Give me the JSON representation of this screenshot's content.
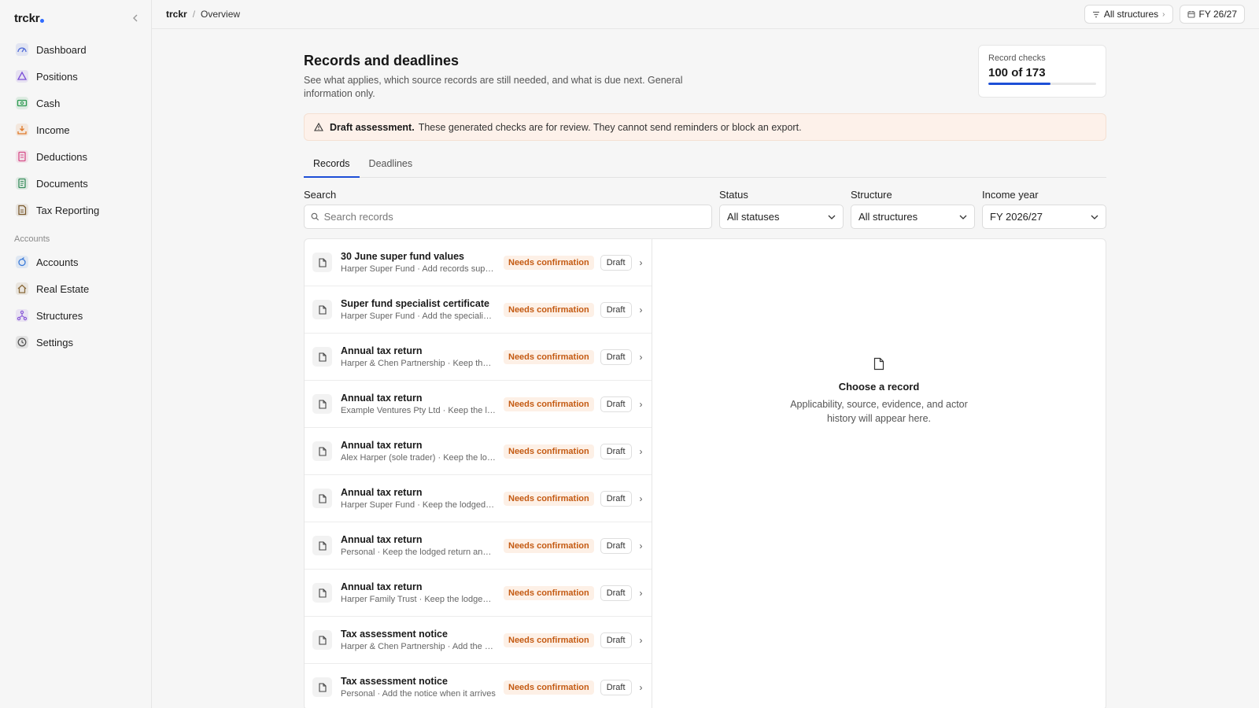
{
  "app": {
    "name": "trckr"
  },
  "sidebar": {
    "items": [
      {
        "label": "Dashboard",
        "icon": "dashboard-icon",
        "color": "#4f6bd8"
      },
      {
        "label": "Positions",
        "icon": "positions-icon",
        "color": "#7b4fd8"
      },
      {
        "label": "Cash",
        "icon": "cash-icon",
        "color": "#2e9a52"
      },
      {
        "label": "Income",
        "icon": "income-icon",
        "color": "#e07a2a"
      },
      {
        "label": "Deductions",
        "icon": "deductions-icon",
        "color": "#d64f8a"
      },
      {
        "label": "Documents",
        "icon": "documents-icon",
        "color": "#3a8f5e"
      },
      {
        "label": "Tax Reporting",
        "icon": "tax-reporting-icon",
        "color": "#7a5a2e"
      }
    ],
    "section_label": "Accounts",
    "account_items": [
      {
        "label": "Accounts",
        "icon": "accounts-icon",
        "color": "#3a7ad8"
      },
      {
        "label": "Real Estate",
        "icon": "real-estate-icon",
        "color": "#8a6a3a"
      },
      {
        "label": "Structures",
        "icon": "structures-icon",
        "color": "#8a5ad8"
      },
      {
        "label": "Settings",
        "icon": "settings-icon",
        "color": "#555555"
      }
    ]
  },
  "topbar": {
    "breadcrumb": [
      "trckr",
      "Overview"
    ],
    "structures_button": "All structures",
    "year_button": "FY 26/27"
  },
  "header": {
    "title": "Records and deadlines",
    "subtitle": "See what applies, which source records are still needed, and what is due next. General information only."
  },
  "checks": {
    "label": "Record checks",
    "value_text": "100 of 173",
    "done": 100,
    "total": 173,
    "accent": "#1d4fd7"
  },
  "banner": {
    "bold": "Draft assessment.",
    "text": "These generated checks are for review. They cannot send reminders or block an export."
  },
  "tabs": [
    {
      "label": "Records",
      "active": true
    },
    {
      "label": "Deadlines",
      "active": false
    }
  ],
  "filters": {
    "search_label": "Search",
    "search_placeholder": "Search records",
    "status_label": "Status",
    "status_value": "All statuses",
    "structure_label": "Structure",
    "structure_value": "All structures",
    "year_label": "Income year",
    "year_value": "FY 2026/27"
  },
  "records": [
    {
      "title": "30 June super fund values",
      "subtitle": "Harper Super Fund · Add records supp...",
      "status": "Needs confirmation",
      "state": "Draft"
    },
    {
      "title": "Super fund specialist certificate",
      "subtitle": "Harper Super Fund · Add the specialist ...",
      "status": "Needs confirmation",
      "state": "Draft"
    },
    {
      "title": "Annual tax return",
      "subtitle": "Harper & Chen Partnership · Keep the l...",
      "status": "Needs confirmation",
      "state": "Draft"
    },
    {
      "title": "Annual tax return",
      "subtitle": "Example Ventures Pty Ltd · Keep the lo...",
      "status": "Needs confirmation",
      "state": "Draft"
    },
    {
      "title": "Annual tax return",
      "subtitle": "Alex Harper (sole trader) · Keep the lod...",
      "status": "Needs confirmation",
      "state": "Draft"
    },
    {
      "title": "Annual tax return",
      "subtitle": "Harper Super Fund · Keep the lodged re...",
      "status": "Needs confirmation",
      "state": "Draft"
    },
    {
      "title": "Annual tax return",
      "subtitle": "Personal · Keep the lodged return and fi...",
      "status": "Needs confirmation",
      "state": "Draft"
    },
    {
      "title": "Annual tax return",
      "subtitle": "Harper Family Trust · Keep the lodged r...",
      "status": "Needs confirmation",
      "state": "Draft"
    },
    {
      "title": "Tax assessment notice",
      "subtitle": "Harper & Chen Partnership · Add the no...",
      "status": "Needs confirmation",
      "state": "Draft"
    },
    {
      "title": "Tax assessment notice",
      "subtitle": "Personal · Add the notice when it arrives",
      "status": "Needs confirmation",
      "state": "Draft"
    }
  ],
  "detail": {
    "empty_title": "Choose a record",
    "empty_subtitle": "Applicability, source, evidence, and actor history will appear here."
  }
}
